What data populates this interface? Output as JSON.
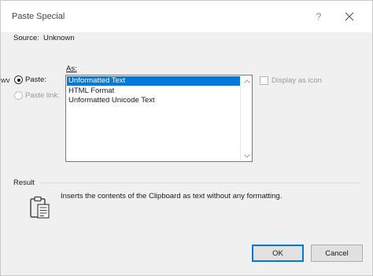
{
  "dialog": {
    "title": "Paste Special",
    "help": "?"
  },
  "source": {
    "label": "Source:",
    "value": "Unknown"
  },
  "cut_text": "wv",
  "as_label": "As:",
  "options": {
    "paste_label": "Paste:",
    "paste_checked": true,
    "paste_link_label": "Paste link:",
    "paste_link_enabled": false
  },
  "formats": [
    {
      "label": "Unformatted Text",
      "selected": true
    },
    {
      "label": "HTML Format",
      "selected": false
    },
    {
      "label": "Unformatted Unicode Text",
      "selected": false
    }
  ],
  "display_as_icon": {
    "label": "Display as icon",
    "checked": false,
    "enabled": false
  },
  "result": {
    "label": "Result",
    "text": "Inserts the contents of the Clipboard as text without any formatting."
  },
  "buttons": {
    "ok": "OK",
    "cancel": "Cancel"
  },
  "colors": {
    "accent": "#0078d7",
    "background": "#f0f0f0"
  }
}
